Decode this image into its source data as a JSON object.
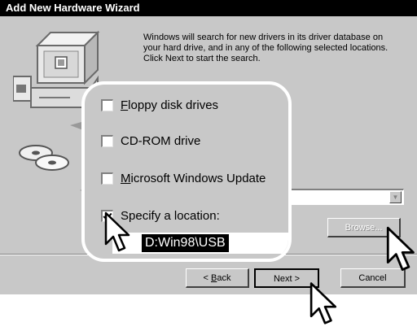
{
  "window": {
    "title": "Add New Hardware Wizard"
  },
  "description": "Windows will search for new drivers in its driver database on your hard drive, and in any of the following selected locations. Click Next to start the search.",
  "options": [
    {
      "label_first": "F",
      "label_rest": "loppy disk drives",
      "checked": false
    },
    {
      "label_first": "",
      "label_rest": "CD-ROM drive",
      "checked": false
    },
    {
      "label_first": "M",
      "label_rest": "icrosoft Windows Update",
      "checked": false
    },
    {
      "label_first": "",
      "label_rest": "Specify a location:",
      "checked": true
    }
  ],
  "location": {
    "value": "D:Win98\\USB",
    "visible_text": "D:Win98\\USB"
  },
  "buttons": {
    "browse": "Browse...",
    "back_first": "< ",
    "back_ul": "B",
    "back_rest": "ack",
    "next": "Next >",
    "cancel": "Cancel"
  },
  "icons": [
    "computer-icon",
    "cd-disc-icon",
    "mouse-cursor-icon"
  ]
}
